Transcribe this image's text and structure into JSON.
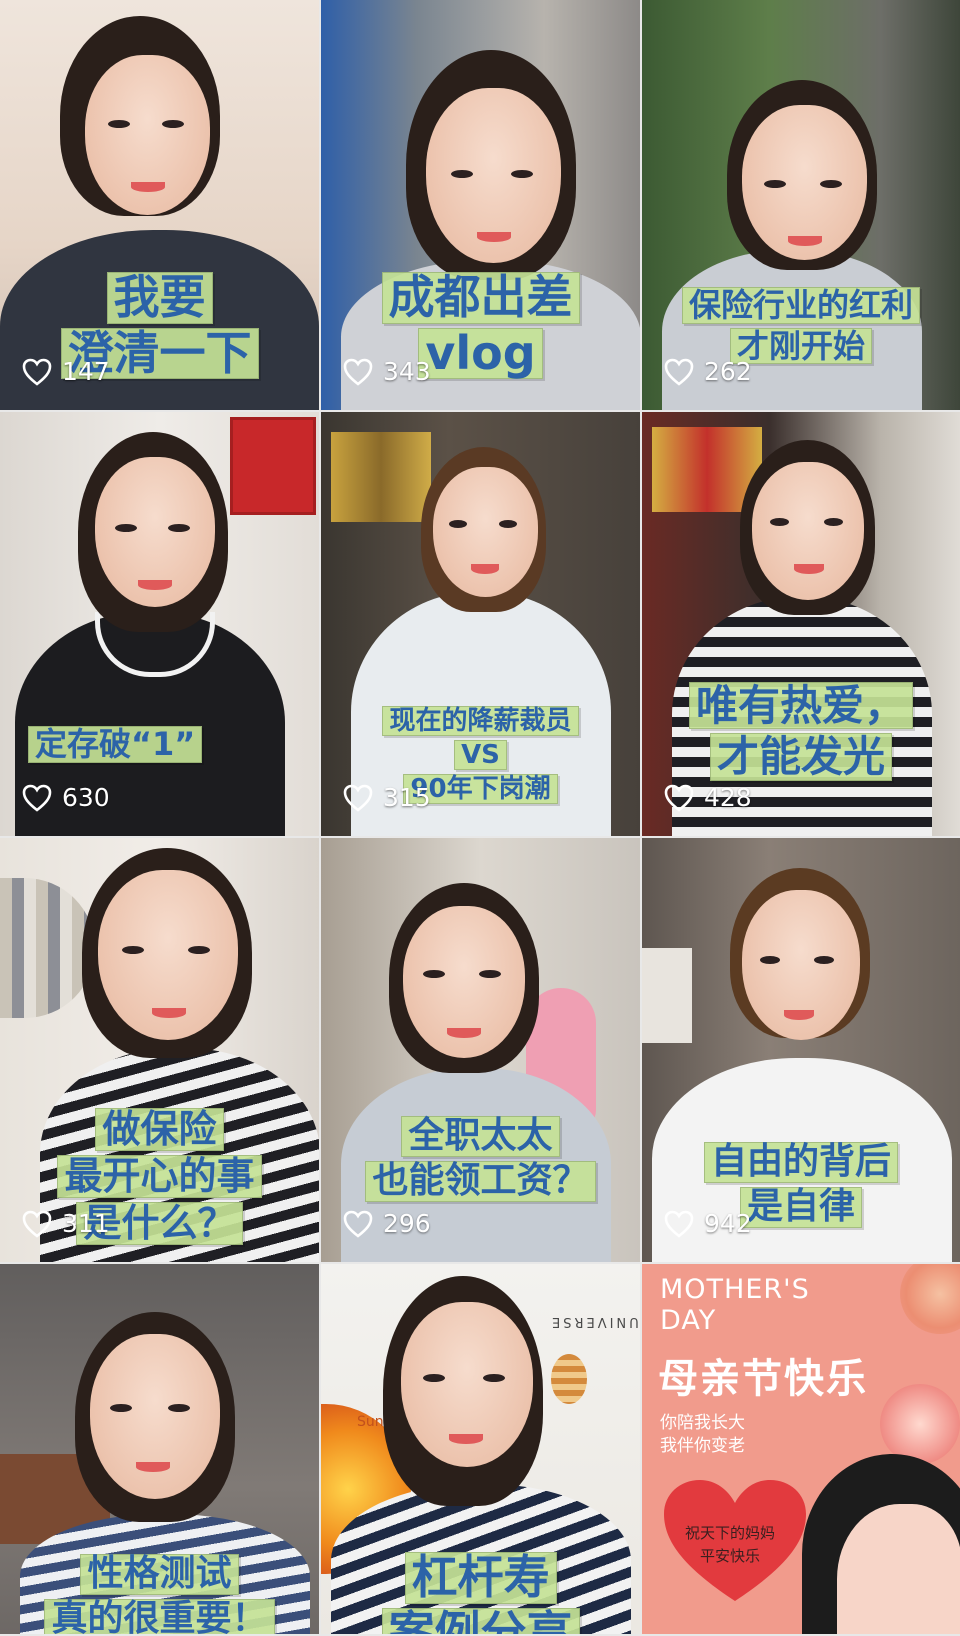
{
  "tiles": [
    {
      "caption": [
        "我要",
        "澄清一下"
      ],
      "likes": "147"
    },
    {
      "caption": [
        "成都出差",
        "vlog"
      ],
      "likes": "343"
    },
    {
      "caption": [
        "保险行业的红利",
        "才刚开始"
      ],
      "likes": "262"
    },
    {
      "caption": [
        "定存破“1”"
      ],
      "likes": "630"
    },
    {
      "caption": [
        "现在的降薪裁员",
        "VS",
        "90年下岗潮"
      ],
      "likes": "315"
    },
    {
      "caption": [
        "唯有热爱，",
        "才能发光"
      ],
      "likes": "428"
    },
    {
      "caption": [
        "做保险",
        "最开心的事",
        "是什么？"
      ],
      "likes": "311"
    },
    {
      "caption": [
        "全职太太",
        "也能领工资？"
      ],
      "likes": "296"
    },
    {
      "caption": [
        "自由的背后",
        "是自律"
      ],
      "likes": "942"
    },
    {
      "caption": [
        "性格测试",
        "真的很重要！"
      ]
    },
    {
      "caption": [
        "杠杆寿",
        "案例分享"
      ],
      "poster_text": [
        "UNIVERSE",
        "Sun"
      ]
    },
    {
      "mothers_day": {
        "en_title": "MOTHER'S DAY",
        "cn_title": "母亲节快乐",
        "subtitle": [
          "你陪我长大",
          "我伴你变老"
        ],
        "heart_text": [
          "祝天下的妈妈",
          "平安快乐"
        ]
      }
    }
  ],
  "icons": {
    "likes": "heart-outline-icon"
  },
  "colors": {
    "caption_text": "#2c63a8",
    "caption_bg": "#c4e296",
    "mothers_day_bg": "#f19b8c"
  }
}
